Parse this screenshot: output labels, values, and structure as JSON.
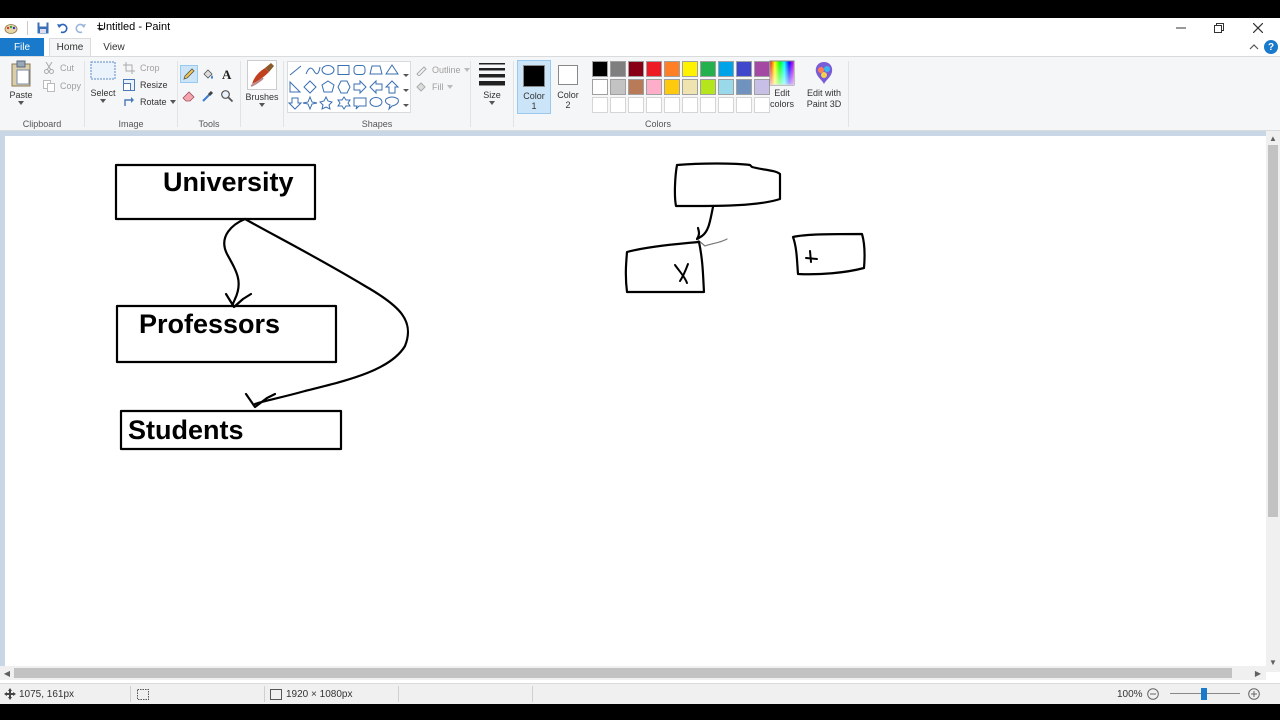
{
  "window": {
    "title": "Untitled - Paint"
  },
  "tabs": {
    "file": "File",
    "home": "Home",
    "view": "View"
  },
  "ribbon": {
    "clipboard": {
      "paste": "Paste",
      "cut": "Cut",
      "copy": "Copy",
      "label": "Clipboard"
    },
    "image": {
      "select": "Select",
      "crop": "Crop",
      "resize": "Resize",
      "rotate": "Rotate",
      "label": "Image"
    },
    "tools": {
      "label": "Tools"
    },
    "brushes": {
      "label": "Brushes"
    },
    "shapes": {
      "outline": "Outline",
      "fill": "Fill",
      "label": "Shapes"
    },
    "size": {
      "label": "Size"
    },
    "colors": {
      "color1_line1": "Color",
      "color1_line2": "1",
      "color2_line1": "Color",
      "color2_line2": "2",
      "edit_colors_line1": "Edit",
      "edit_colors_line2": "colors",
      "edit_3d_line1": "Edit with",
      "edit_3d_line2": "Paint 3D",
      "label": "Colors",
      "color1_value": "#000000",
      "color2_value": "#ffffff",
      "palette_row1": [
        "#000000",
        "#7f7f7f",
        "#880015",
        "#ed1c24",
        "#ff7f27",
        "#fff200",
        "#22b14c",
        "#00a2e8",
        "#3f48cc",
        "#a349a4"
      ],
      "palette_row2": [
        "#ffffff",
        "#c3c3c3",
        "#b97a57",
        "#ffaec9",
        "#ffc90e",
        "#efe4b0",
        "#b5e61d",
        "#99d9ea",
        "#7092be",
        "#c8bfe7"
      ]
    }
  },
  "canvas": {
    "university": "University",
    "professors": "Professors",
    "students": "Students",
    "x_mark_1": "X",
    "x_mark_2": "+"
  },
  "status": {
    "cursor_pos": "1075, 161px",
    "image_size": "1920 × 1080px",
    "zoom": "100%"
  }
}
